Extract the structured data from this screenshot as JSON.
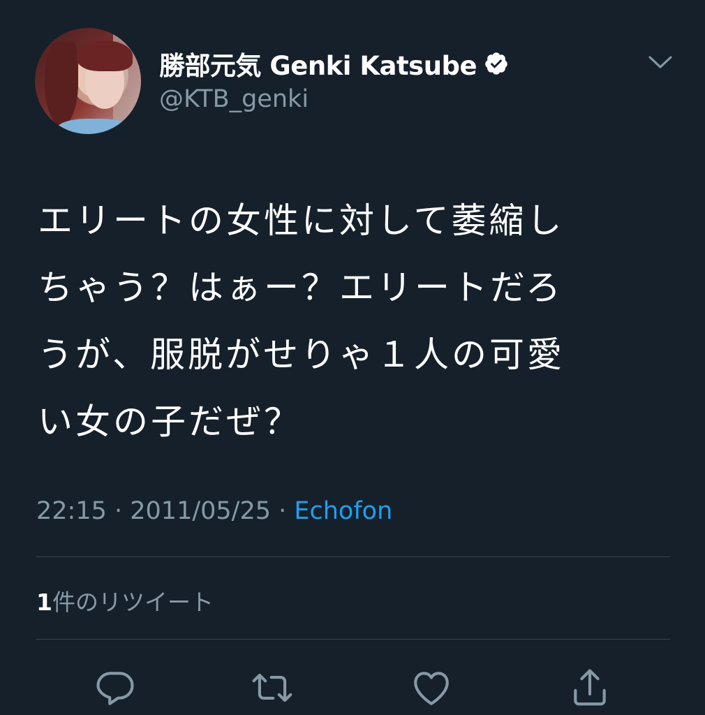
{
  "user": {
    "display_name": "勝部元気 Genki Katsube",
    "handle": "@KTB_genki",
    "verified": true
  },
  "tweet": {
    "text_lines": [
      "エリートの女性に対して萎縮し",
      "ちゃう？はぁー？エリートだろ",
      "うが、服脱がせりゃ１人の可愛",
      "い女の子だぜ？"
    ]
  },
  "meta": {
    "time": "22:15",
    "separator1": " · ",
    "date": "2011/05/25",
    "separator2": " · ",
    "source": "Echofon"
  },
  "stats": {
    "retweet_count": "1",
    "retweet_label": "件のリツイート"
  },
  "actions": {
    "icons": [
      "reply-icon",
      "retweet-icon",
      "like-icon",
      "share-icon"
    ]
  },
  "colors": {
    "background": "#15202b",
    "primary_text": "#ffffff",
    "secondary_text": "#8899a6",
    "link": "#1da1f2",
    "divider": "#38444d"
  }
}
